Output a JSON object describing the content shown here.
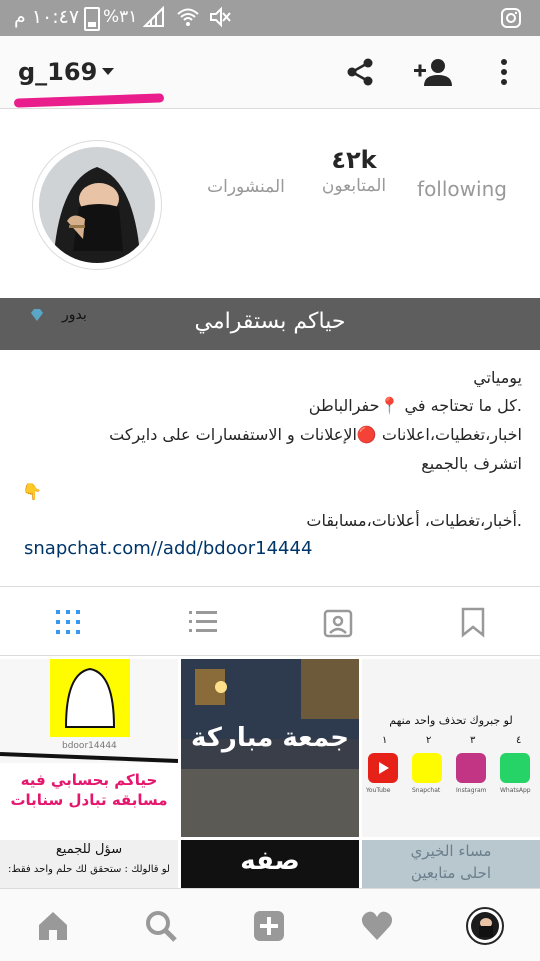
{
  "status_bar": {
    "time": "١٠:٤٧ م",
    "battery": "%٣١"
  },
  "header": {
    "username": "g_169"
  },
  "stats": [
    {
      "value": "",
      "label": "المنشورات"
    },
    {
      "value": "٤٢k",
      "label": "المتابعون"
    },
    {
      "value": "",
      "label": "following"
    }
  ],
  "banner": {
    "title": "حياكم بستقرامي",
    "name": "بدور"
  },
  "bio": {
    "line1": "يومياتي",
    "line2": ".كل ما تحتاجه في 📍حفرالباطن",
    "line3": "اخبار،تغطيات،اعلانات 🔴الإعلانات و الاستفسارات  على دايركت",
    "line4": "اتشرف بالجميع",
    "line5": "👇",
    "line6": ".أخبار،تغطيات، أعلانات،مسابقات",
    "link": "snapchat.com//add/bdoor14444"
  },
  "tiles": {
    "t1_handle": "bdoor14444",
    "t1_caption1": "حياكم بحسابي فيه",
    "t1_caption2": "مسابقه تبادل سنابات",
    "t2_caption": "جمعة مباركة",
    "t3_header": "لو جبروك تحذف واحد منهم",
    "t3_apps": [
      "YouTube",
      "Snapchat",
      "Instagram",
      "WhatsApp"
    ],
    "t3_nums": [
      "١",
      "٢",
      "٣",
      "٤"
    ],
    "t4_line1": "سؤل للجميع",
    "t4_line2": "لو قالولك : ستحقق لك حلم واحد فقط:",
    "t5_caption": "صفه",
    "t6_line1": "مساء الخيري",
    "t6_line2": "احلى متابعين"
  },
  "colors": {
    "accent": "#3897f0",
    "banner": "#5e5e5e",
    "highlight": "#e91e8c",
    "link": "#003569"
  }
}
